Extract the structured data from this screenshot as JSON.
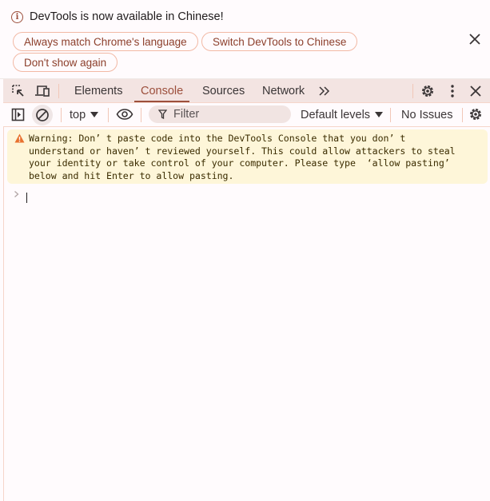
{
  "infobar": {
    "message": "DevTools is now available in Chinese!",
    "buttons": [
      {
        "label": "Always match Chrome's language"
      },
      {
        "label": "Switch DevTools to Chinese"
      },
      {
        "label": "Don't show again"
      }
    ],
    "close_icon": "close-icon"
  },
  "tabbar": {
    "left_icons": [
      "inspect-element-icon",
      "device-toolbar-icon"
    ],
    "tabs": [
      {
        "label": "Elements",
        "active": false
      },
      {
        "label": "Console",
        "active": true
      },
      {
        "label": "Sources",
        "active": false
      },
      {
        "label": "Network",
        "active": false
      }
    ],
    "more_tabs_label": "»",
    "right_icons": [
      "settings-icon",
      "more-options-icon",
      "close-icon"
    ]
  },
  "toolbar": {
    "context": "top",
    "filter_placeholder": "Filter",
    "filter_value": "",
    "levels": "Default levels",
    "issues": "No Issues"
  },
  "console": {
    "warning_text": "Warning: Don’t paste code into the DevTools Console that you don’t understand or haven’t reviewed yourself. This could allow attackers to steal your identity or take control of your computer. Please type ‘allow pasting’ below and hit Enter to allow pasting.",
    "warning_lines": [
      "Warning: Don’ t paste code into the DevTools Console that you don’ t",
      "understand or haven’ t reviewed yourself. This could allow attackers to steal",
      "your identity or take control of your computer. Please type  ‘allow pasting’",
      "below and hit Enter to allow pasting."
    ],
    "prompt_symbol": "›",
    "input_value": ""
  },
  "colors": {
    "accent": "#9c4f3c",
    "pill_border": "#f2b9a5",
    "tabbar_bg": "#f3e4e2",
    "warning_bg": "#fef6d9",
    "warning_icon": "#e8712f",
    "page_bg": "#fffbfd"
  }
}
